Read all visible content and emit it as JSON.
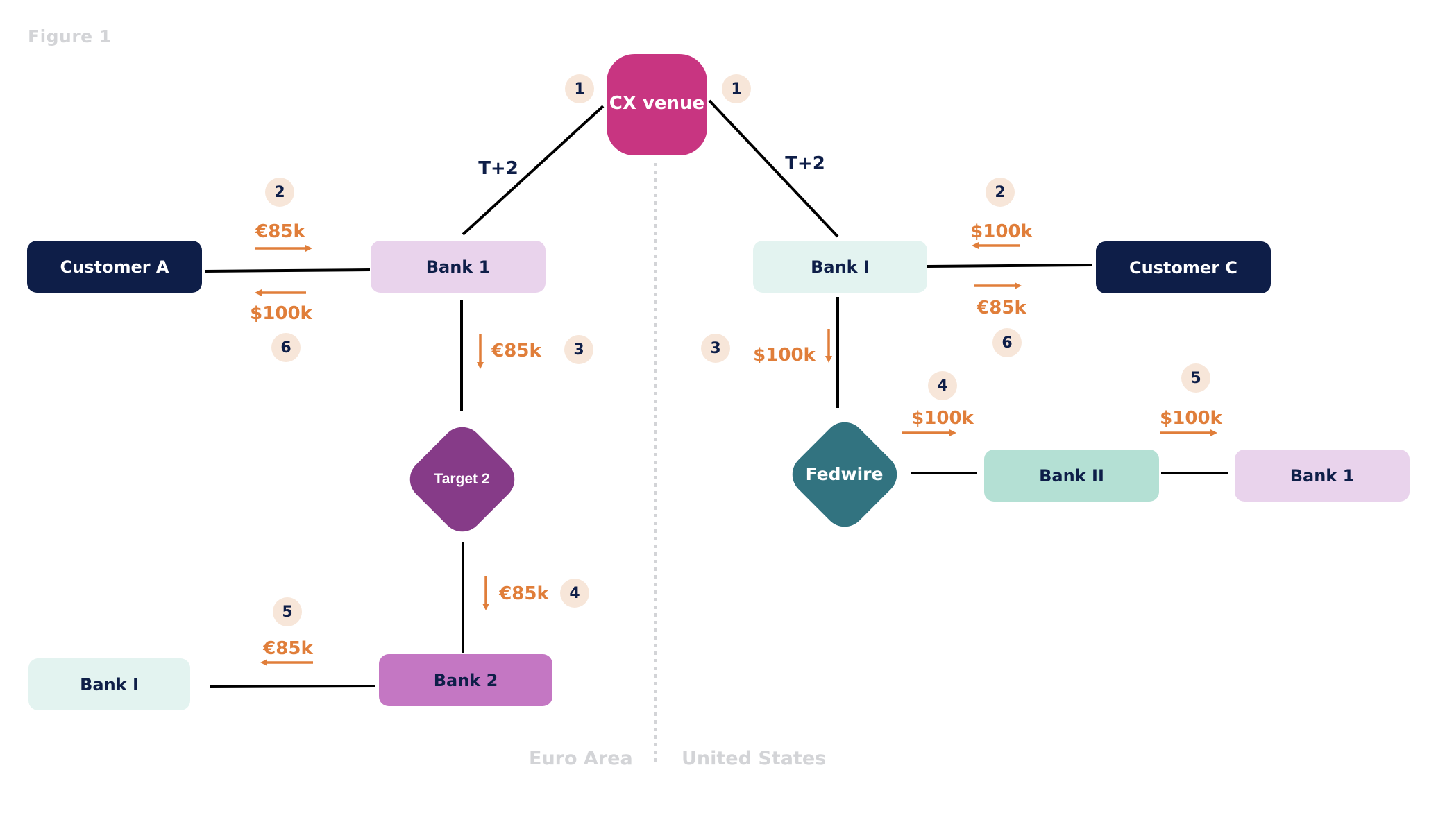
{
  "figure_title": "Figure 1",
  "regions": {
    "left": "Euro Area",
    "right": "United States"
  },
  "colors": {
    "navy": "#0e1e48",
    "orange": "#e07e3a",
    "cx_venue": "#c83581",
    "target2": "#863b88",
    "fedwire": "#327380",
    "step_badge": "#f7e6d9",
    "divider": "#d3d4d7"
  },
  "venue": {
    "label": "CX venue",
    "left_settlement": "T+2",
    "right_settlement": "T+2"
  },
  "euro_area": {
    "customer": "Customer A",
    "bank_1": "Bank 1",
    "settlement_system": "Target 2",
    "bank_2": "Bank 2",
    "bank_i": "Bank I"
  },
  "united_states": {
    "bank_i": "Bank I",
    "customer": "Customer C",
    "settlement_system": "Fedwire",
    "bank_ii": "Bank II",
    "bank_1": "Bank 1"
  },
  "flows": {
    "eu_step1": "1",
    "us_step1": "1",
    "eu_customer_to_bank": {
      "step": "2",
      "amount": "€85k",
      "direction": "right"
    },
    "eu_bank_to_customer": {
      "step": "6",
      "amount": "$100k",
      "direction": "left"
    },
    "eu_bank1_to_target2": {
      "step": "3",
      "amount": "€85k",
      "direction": "down"
    },
    "eu_target2_to_bank2": {
      "step": "4",
      "amount": "€85k",
      "direction": "down"
    },
    "eu_bank2_to_banki": {
      "step": "5",
      "amount": "€85k",
      "direction": "left"
    },
    "us_customer_to_bank": {
      "step": "2",
      "amount": "$100k",
      "direction": "left"
    },
    "us_bank_to_customer": {
      "step": "6",
      "amount": "€85k",
      "direction": "right"
    },
    "us_banki_to_fedwire": {
      "step": "3",
      "amount": "$100k",
      "direction": "down"
    },
    "us_fedwire_to_bankii": {
      "step": "4",
      "amount": "$100k",
      "direction": "right"
    },
    "us_bankii_to_bank1": {
      "step": "5",
      "amount": "$100k",
      "direction": "right"
    }
  }
}
